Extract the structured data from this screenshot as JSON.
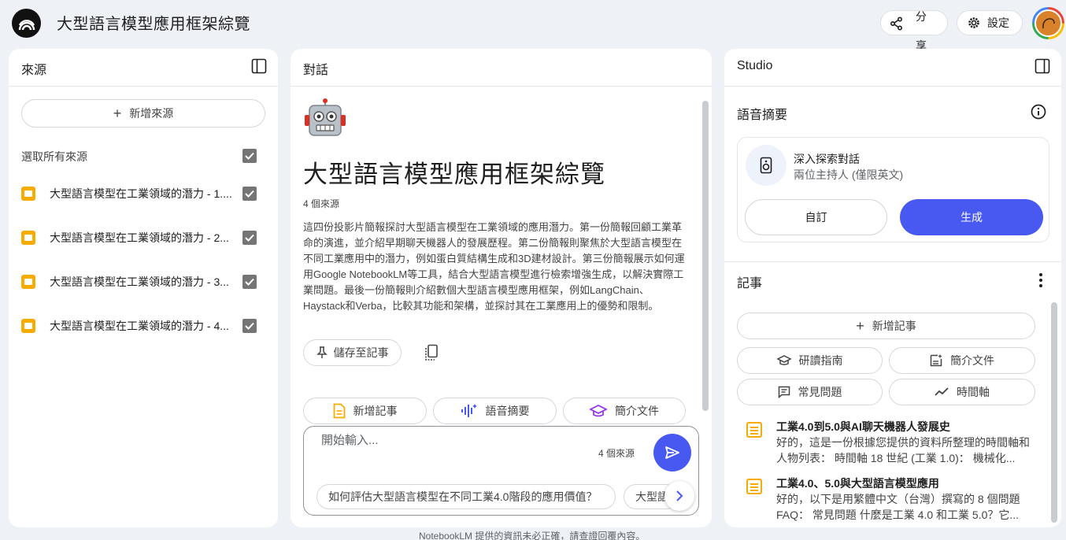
{
  "header": {
    "title": "大型語言模型應用框架綜覽",
    "share_label": "分享",
    "settings_label": "設定"
  },
  "sources": {
    "title": "來源",
    "add_label": "新增來源",
    "select_all_label": "選取所有來源",
    "items": [
      {
        "label": "大型語言模型在工業領域的潛力 - 1...."
      },
      {
        "label": "大型語言模型在工業領域的潛力 - 2..."
      },
      {
        "label": "大型語言模型在工業領域的潛力 - 3..."
      },
      {
        "label": "大型語言模型在工業領域的潛力 - 4..."
      }
    ]
  },
  "chat": {
    "title": "對話",
    "notebook_title": "大型語言模型應用框架綜覽",
    "source_count": "4 個來源",
    "summary": "這四份投影片簡報探討大型語言模型在工業領域的應用潛力。第一份簡報回顧工業革命的演進，並介紹早期聊天機器人的發展歷程。第二份簡報則聚焦於大型語言模型在不同工業應用中的潛力，例如蛋白質結構生成和3D建材設計。第三份簡報展示如何運用Google NotebookLM等工具，結合大型語言模型進行檢索增強生成，以解決實際工業問題。最後一份簡報則介紹數個大型語言模型應用框架，例如LangChain、Haystack和Verba，比較其功能和架構，並探討其在工業應用上的優勢和限制。",
    "save_note_label": "儲存至記事",
    "actions": {
      "add_note": "新增記事",
      "audio_overview": "語音摘要",
      "briefing": "簡介文件"
    },
    "input_placeholder": "開始輸入...",
    "input_source_count": "4 個來源",
    "suggestions": [
      "如何評估大型語言模型在不同工業4.0階段的應用價值？",
      "大型語"
    ]
  },
  "studio": {
    "title": "Studio",
    "audio": {
      "section_title": "語音摘要",
      "card_title": "深入探索對話",
      "card_subtitle": "兩位主持人 (僅限英文)",
      "customize_label": "自訂",
      "generate_label": "生成"
    },
    "notes": {
      "section_title": "記事",
      "add_label": "新增記事",
      "study_guide": "研讀指南",
      "briefing_doc": "簡介文件",
      "faq": "常見問題",
      "timeline": "時間軸",
      "items": [
        {
          "title": "工業4.0到5.0與AI聊天機器人發展史",
          "preview": "好的，這是一份根據您提供的資料所整理的時間軸和人物列表： 時間軸 18 世紀 (工業 1.0)： 機械化..."
        },
        {
          "title": "工業4.0、5.0與大型語言模型應用",
          "preview": "好的，以下是用繁體中文（台灣）撰寫的 8 個問題 FAQ： 常見問題 什麼是工業 4.0 和工業 5.0？它..."
        }
      ]
    }
  },
  "footer": "NotebookLM 提供的資訊未必正確，請查證回覆內容。",
  "colors": {
    "accent": "#4759f0",
    "source_icon": "#f9ab00",
    "background": "#eef1f6"
  }
}
